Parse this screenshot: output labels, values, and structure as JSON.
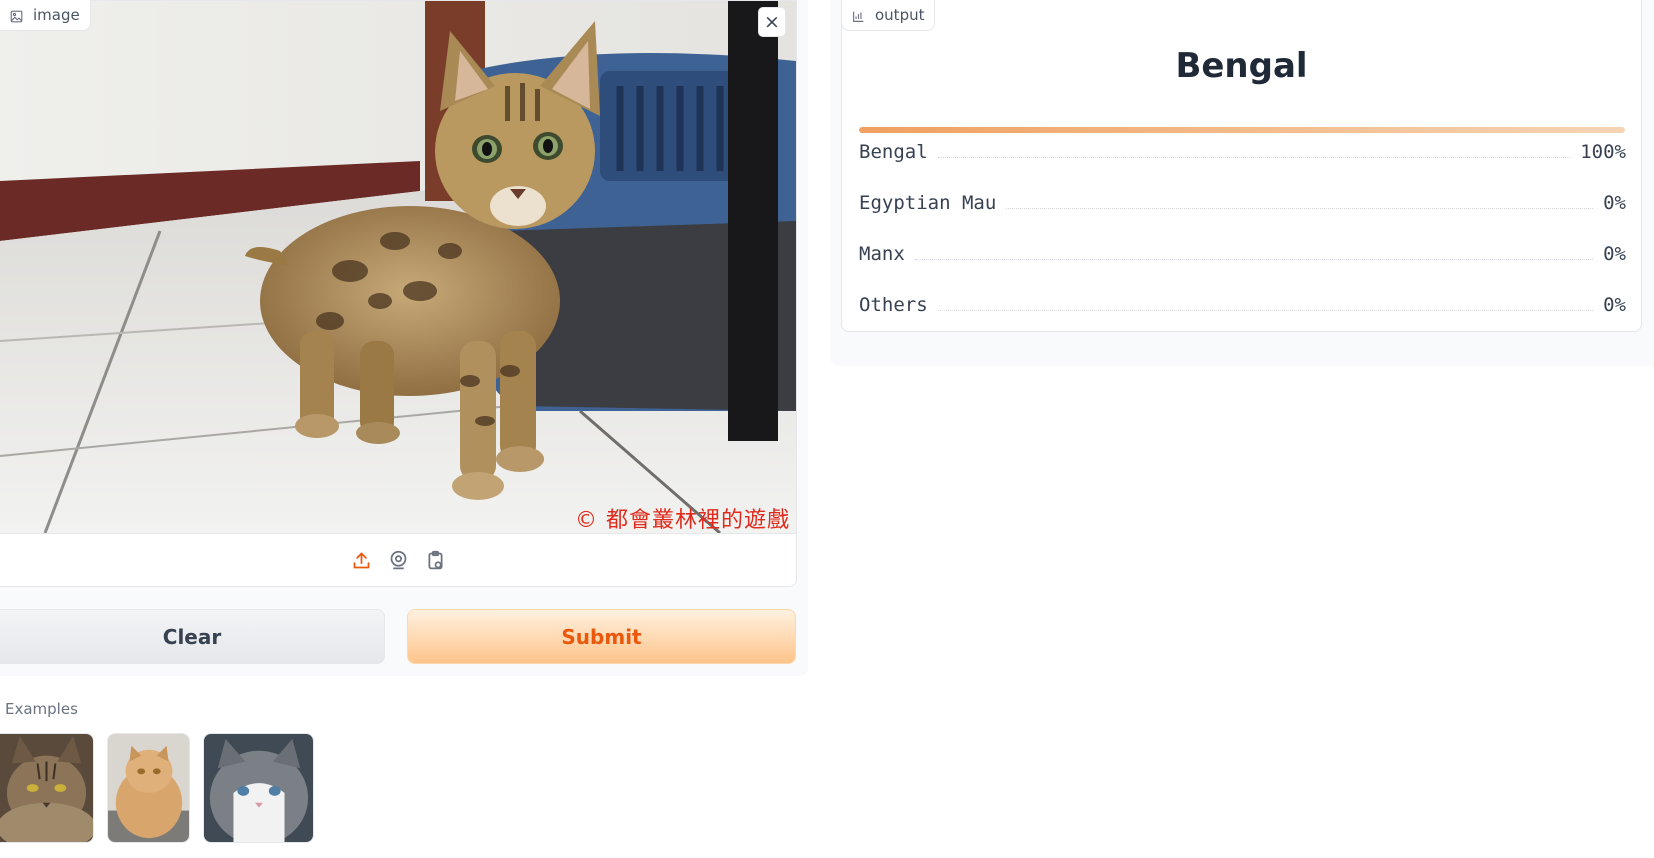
{
  "input": {
    "label": "image",
    "close_glyph": "×",
    "watermark": "© 都會叢林裡的遊戲",
    "toolbar_icons": [
      "upload-icon",
      "webcam-icon",
      "clipboard-icon"
    ]
  },
  "buttons": {
    "clear": "Clear",
    "submit": "Submit"
  },
  "examples": {
    "label": "Examples",
    "count": 3
  },
  "output": {
    "label": "output",
    "top_label": "Bengal",
    "top_confidence": 1.0,
    "confidences": [
      {
        "label": "Bengal",
        "value": "100%"
      },
      {
        "label": "Egyptian Mau",
        "value": "0%"
      },
      {
        "label": "Manx",
        "value": "0%"
      },
      {
        "label": "Others",
        "value": "0%"
      }
    ]
  },
  "colors": {
    "accent": "#ea580c",
    "submit_bg": "#fdc48a",
    "watermark": "#e02a1c",
    "bar_start": "#f0a060",
    "bar_end": "#f5d5b5"
  }
}
